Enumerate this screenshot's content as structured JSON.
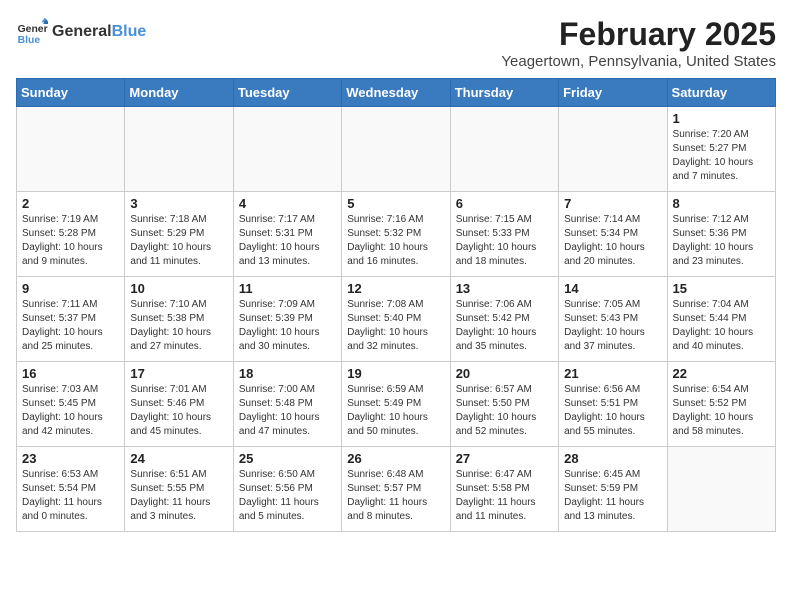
{
  "logo": {
    "text_general": "General",
    "text_blue": "Blue"
  },
  "title": "February 2025",
  "subtitle": "Yeagertown, Pennsylvania, United States",
  "weekdays": [
    "Sunday",
    "Monday",
    "Tuesday",
    "Wednesday",
    "Thursday",
    "Friday",
    "Saturday"
  ],
  "weeks": [
    [
      {
        "day": "",
        "info": ""
      },
      {
        "day": "",
        "info": ""
      },
      {
        "day": "",
        "info": ""
      },
      {
        "day": "",
        "info": ""
      },
      {
        "day": "",
        "info": ""
      },
      {
        "day": "",
        "info": ""
      },
      {
        "day": "1",
        "info": "Sunrise: 7:20 AM\nSunset: 5:27 PM\nDaylight: 10 hours\nand 7 minutes."
      }
    ],
    [
      {
        "day": "2",
        "info": "Sunrise: 7:19 AM\nSunset: 5:28 PM\nDaylight: 10 hours\nand 9 minutes."
      },
      {
        "day": "3",
        "info": "Sunrise: 7:18 AM\nSunset: 5:29 PM\nDaylight: 10 hours\nand 11 minutes."
      },
      {
        "day": "4",
        "info": "Sunrise: 7:17 AM\nSunset: 5:31 PM\nDaylight: 10 hours\nand 13 minutes."
      },
      {
        "day": "5",
        "info": "Sunrise: 7:16 AM\nSunset: 5:32 PM\nDaylight: 10 hours\nand 16 minutes."
      },
      {
        "day": "6",
        "info": "Sunrise: 7:15 AM\nSunset: 5:33 PM\nDaylight: 10 hours\nand 18 minutes."
      },
      {
        "day": "7",
        "info": "Sunrise: 7:14 AM\nSunset: 5:34 PM\nDaylight: 10 hours\nand 20 minutes."
      },
      {
        "day": "8",
        "info": "Sunrise: 7:12 AM\nSunset: 5:36 PM\nDaylight: 10 hours\nand 23 minutes."
      }
    ],
    [
      {
        "day": "9",
        "info": "Sunrise: 7:11 AM\nSunset: 5:37 PM\nDaylight: 10 hours\nand 25 minutes."
      },
      {
        "day": "10",
        "info": "Sunrise: 7:10 AM\nSunset: 5:38 PM\nDaylight: 10 hours\nand 27 minutes."
      },
      {
        "day": "11",
        "info": "Sunrise: 7:09 AM\nSunset: 5:39 PM\nDaylight: 10 hours\nand 30 minutes."
      },
      {
        "day": "12",
        "info": "Sunrise: 7:08 AM\nSunset: 5:40 PM\nDaylight: 10 hours\nand 32 minutes."
      },
      {
        "day": "13",
        "info": "Sunrise: 7:06 AM\nSunset: 5:42 PM\nDaylight: 10 hours\nand 35 minutes."
      },
      {
        "day": "14",
        "info": "Sunrise: 7:05 AM\nSunset: 5:43 PM\nDaylight: 10 hours\nand 37 minutes."
      },
      {
        "day": "15",
        "info": "Sunrise: 7:04 AM\nSunset: 5:44 PM\nDaylight: 10 hours\nand 40 minutes."
      }
    ],
    [
      {
        "day": "16",
        "info": "Sunrise: 7:03 AM\nSunset: 5:45 PM\nDaylight: 10 hours\nand 42 minutes."
      },
      {
        "day": "17",
        "info": "Sunrise: 7:01 AM\nSunset: 5:46 PM\nDaylight: 10 hours\nand 45 minutes."
      },
      {
        "day": "18",
        "info": "Sunrise: 7:00 AM\nSunset: 5:48 PM\nDaylight: 10 hours\nand 47 minutes."
      },
      {
        "day": "19",
        "info": "Sunrise: 6:59 AM\nSunset: 5:49 PM\nDaylight: 10 hours\nand 50 minutes."
      },
      {
        "day": "20",
        "info": "Sunrise: 6:57 AM\nSunset: 5:50 PM\nDaylight: 10 hours\nand 52 minutes."
      },
      {
        "day": "21",
        "info": "Sunrise: 6:56 AM\nSunset: 5:51 PM\nDaylight: 10 hours\nand 55 minutes."
      },
      {
        "day": "22",
        "info": "Sunrise: 6:54 AM\nSunset: 5:52 PM\nDaylight: 10 hours\nand 58 minutes."
      }
    ],
    [
      {
        "day": "23",
        "info": "Sunrise: 6:53 AM\nSunset: 5:54 PM\nDaylight: 11 hours\nand 0 minutes."
      },
      {
        "day": "24",
        "info": "Sunrise: 6:51 AM\nSunset: 5:55 PM\nDaylight: 11 hours\nand 3 minutes."
      },
      {
        "day": "25",
        "info": "Sunrise: 6:50 AM\nSunset: 5:56 PM\nDaylight: 11 hours\nand 5 minutes."
      },
      {
        "day": "26",
        "info": "Sunrise: 6:48 AM\nSunset: 5:57 PM\nDaylight: 11 hours\nand 8 minutes."
      },
      {
        "day": "27",
        "info": "Sunrise: 6:47 AM\nSunset: 5:58 PM\nDaylight: 11 hours\nand 11 minutes."
      },
      {
        "day": "28",
        "info": "Sunrise: 6:45 AM\nSunset: 5:59 PM\nDaylight: 11 hours\nand 13 minutes."
      },
      {
        "day": "",
        "info": ""
      }
    ]
  ]
}
